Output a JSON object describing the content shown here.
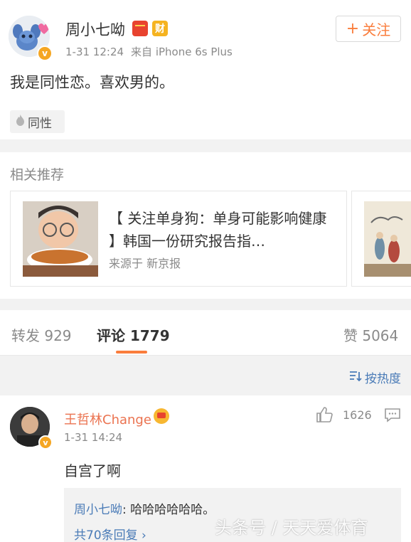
{
  "post": {
    "username": "周小七呦",
    "badge_cai": "财",
    "time": "1-31 12:24",
    "source": "来自 iPhone 6s Plus",
    "follow_label": "关注",
    "follow_plus": "+",
    "text": "我是同性恋。喜欢男的。",
    "topic_tag": "同性",
    "verified_glyph": "v"
  },
  "related": {
    "title": "相关推荐",
    "card": {
      "headline": "【 关注单身狗：单身可能影响健康 】韩国一份研究报告指…",
      "source": "来源于 新京报"
    }
  },
  "tabs": {
    "repost": "转发 929",
    "comments": "评论 1779",
    "likes": "赞 5064"
  },
  "sort": {
    "label": "按热度"
  },
  "comment": {
    "username": "王哲林Change",
    "time": "1-31 14:24",
    "like_count": "1626",
    "text": "自宫了啊",
    "verified_glyph": "v",
    "reply": {
      "author": "周小七呦",
      "text": ": 哈哈哈哈哈哈。",
      "more": "共70条回复 ›"
    }
  },
  "watermark": "头条号 / 天天爱体育",
  "colors": {
    "accent_orange": "#fa7d3c",
    "link_blue": "#4a7bb7",
    "name_orange": "#eb7350",
    "verified_gold": "#f5a623"
  },
  "icons": [
    "flame-icon",
    "sort-icon",
    "thumbs-up-icon",
    "comment-reply-icon",
    "red-envelope-icon",
    "crown-icon",
    "verified-icon"
  ]
}
